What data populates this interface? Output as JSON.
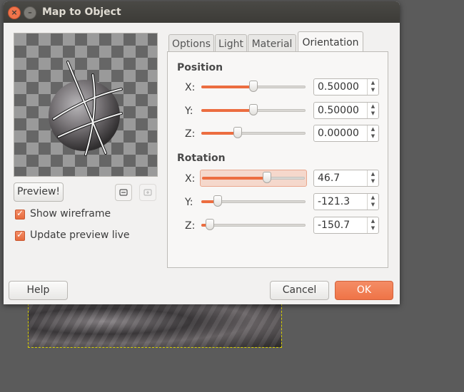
{
  "window": {
    "title": "Map to Object"
  },
  "left": {
    "preview_button": "Preview!",
    "zoom_out_icon": "zoom-out-icon",
    "zoom_in_icon": "zoom-in-icon",
    "show_wireframe": {
      "label": "Show wireframe",
      "checked": true
    },
    "update_preview": {
      "label": "Update preview live",
      "checked": true
    }
  },
  "tabs": [
    "Options",
    "Light",
    "Material",
    "Orientation"
  ],
  "active_tab": "Orientation",
  "position": {
    "heading": "Position",
    "rows": [
      {
        "axis": "X:",
        "value": "0.50000",
        "fraction": 0.5
      },
      {
        "axis": "Y:",
        "value": "0.50000",
        "fraction": 0.5
      },
      {
        "axis": "Z:",
        "value": "0.00000",
        "fraction": 0.35
      }
    ]
  },
  "rotation": {
    "heading": "Rotation",
    "rows": [
      {
        "axis": "X:",
        "value": "46.7",
        "fraction": 0.63
      },
      {
        "axis": "Y:",
        "value": "-121.3",
        "fraction": 0.16
      },
      {
        "axis": "Z:",
        "value": "-150.7",
        "fraction": 0.08
      }
    ]
  },
  "footer": {
    "help": "Help",
    "cancel": "Cancel",
    "ok": "OK"
  },
  "colors": {
    "accent": "#ef7447",
    "titlebar": "#3c3b37",
    "close": "#f0744b"
  }
}
